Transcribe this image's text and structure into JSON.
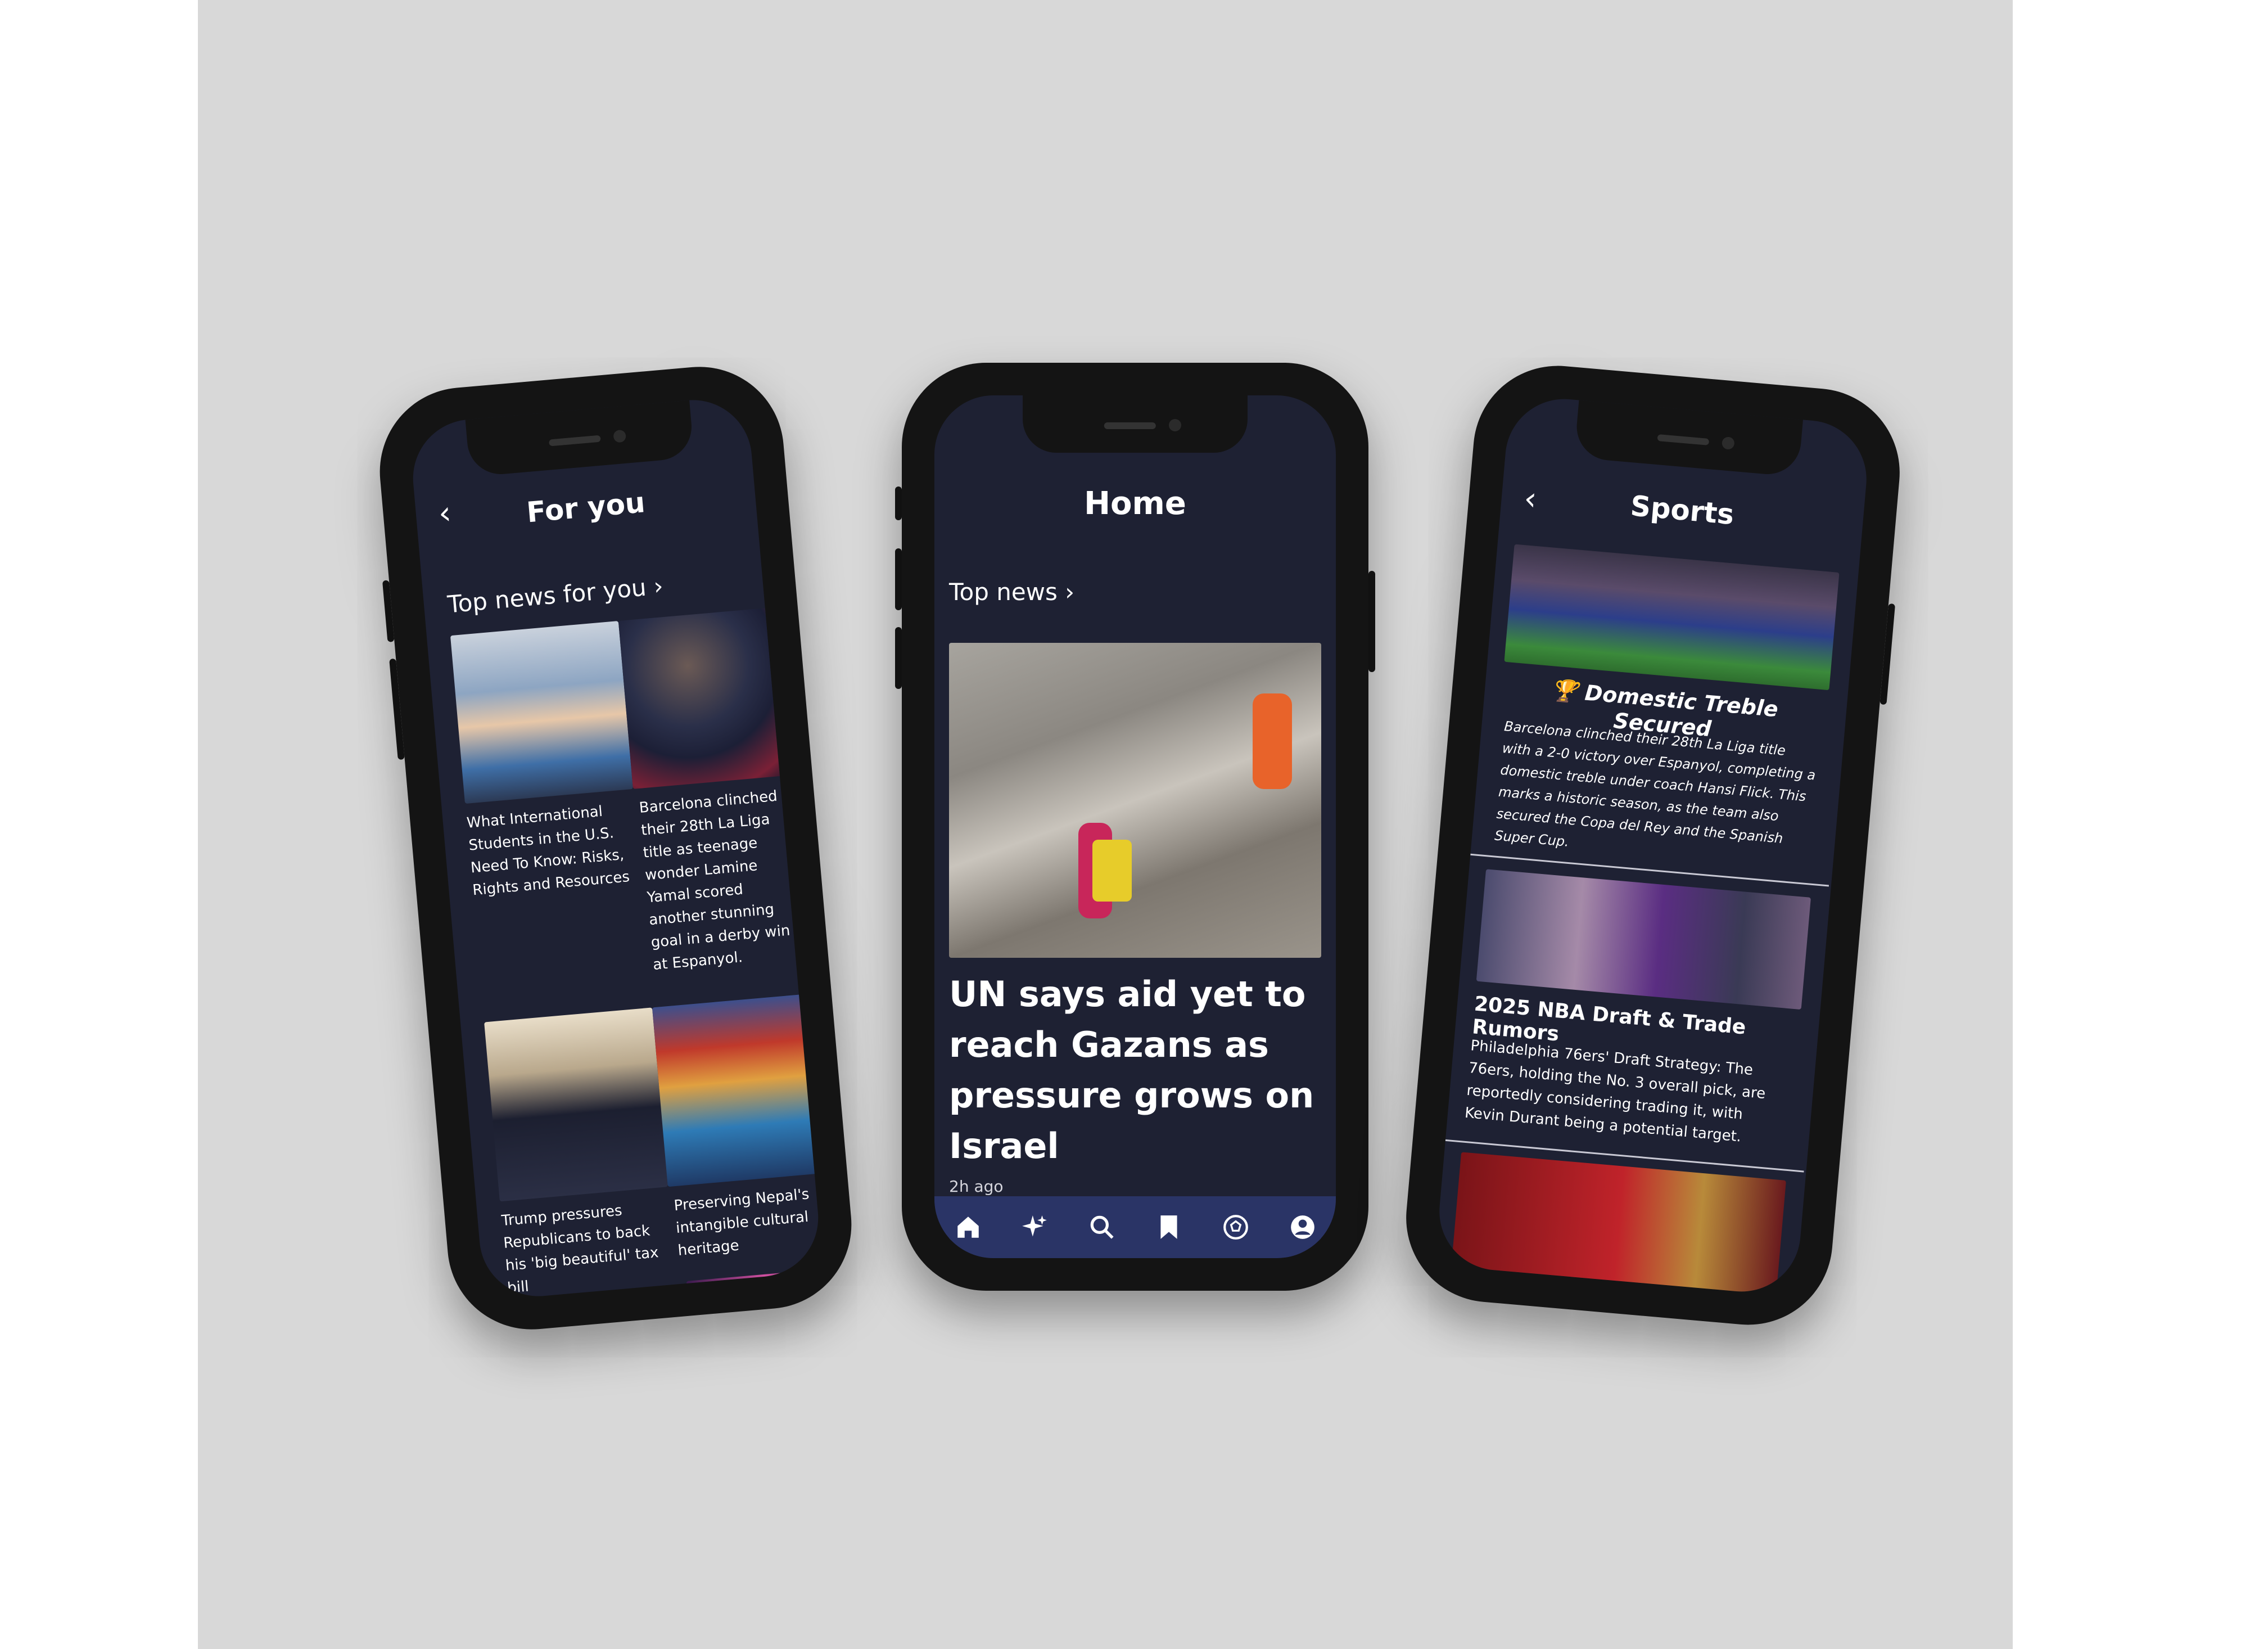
{
  "left_screen": {
    "title": "For you",
    "back_icon": "chevron-left-icon",
    "section": "Top news for you ›",
    "cards": [
      {
        "caption": "What International Students in the U.S. Need To Know: Risks, Rights and Resources"
      },
      {
        "caption": "Barcelona clinched their 28th La Liga title as teenage wonder Lamine Yamal scored another stunning goal in a derby win at Espanyol."
      },
      {
        "caption": "Trump pressures Republicans to back his 'big beautiful' tax bill"
      },
      {
        "caption": "Preserving Nepal's intangible cultural heritage"
      }
    ]
  },
  "center_screen": {
    "title": "Home",
    "section": "Top news ›",
    "headline": "UN says aid yet to reach Gazans as pressure grows on Israel",
    "time": "2h ago",
    "nav": [
      "home-icon",
      "sparkles-icon",
      "search-icon",
      "bookmark-icon",
      "football-icon",
      "profile-icon"
    ]
  },
  "right_screen": {
    "title": "Sports",
    "back_icon": "chevron-left-icon",
    "story1_title": "🏆 Domestic Treble Secured",
    "story1_body": "Barcelona clinched their 28th La Liga title with a 2-0 victory over Espanyol, completing a domestic treble under coach Hansi Flick. This marks a historic season, as the team also secured the Copa del Rey and the Spanish Super Cup.",
    "story2_title": "2025 NBA Draft & Trade Rumors",
    "story2_body": "Philadelphia 76ers' Draft Strategy: The 76ers, holding the No. 3 overall pick, are reportedly considering trading it, with Kevin Durant being a potential target."
  },
  "colors": {
    "screen_bg": "#1e2133",
    "nav_bg": "#2a3466",
    "background": "#d8d8d8"
  }
}
